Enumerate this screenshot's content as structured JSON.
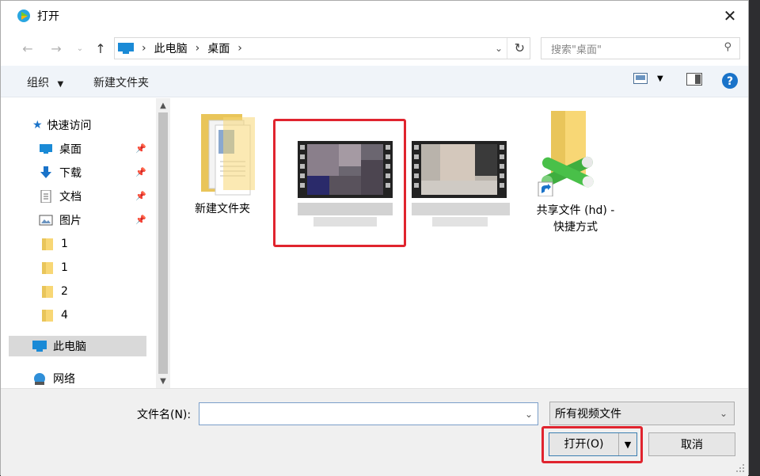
{
  "window": {
    "title": "打开"
  },
  "nav": {
    "back_icon": "back-arrow-icon",
    "forward_icon": "forward-arrow-icon",
    "up_icon": "up-arrow-icon",
    "breadcrumbs": [
      "此电脑",
      "桌面"
    ],
    "search_placeholder": "搜索\"桌面\""
  },
  "toolbar": {
    "organize_label": "组织",
    "new_folder_label": "新建文件夹"
  },
  "sidebar": {
    "items": [
      {
        "label": "快速访问",
        "icon": "star-icon"
      },
      {
        "label": "桌面",
        "icon": "desktop-icon",
        "pinned": true
      },
      {
        "label": "下载",
        "icon": "download-icon",
        "pinned": true
      },
      {
        "label": "文档",
        "icon": "document-icon",
        "pinned": true
      },
      {
        "label": "图片",
        "icon": "picture-icon",
        "pinned": true
      },
      {
        "label": "1",
        "icon": "folder-icon"
      },
      {
        "label": "1",
        "icon": "folder-icon"
      },
      {
        "label": "2",
        "icon": "folder-icon"
      },
      {
        "label": "4",
        "icon": "folder-icon"
      },
      {
        "label": "此电脑",
        "icon": "computer-icon",
        "selected": true
      },
      {
        "label": "网络",
        "icon": "network-icon"
      }
    ]
  },
  "files": [
    {
      "label": "新建文件夹",
      "type": "folder"
    },
    {
      "label": "",
      "type": "video",
      "highlighted": true
    },
    {
      "label": "",
      "type": "video"
    },
    {
      "label_line1": "共享文件 (hd) -",
      "label_line2": "快捷方式",
      "type": "shortcut"
    }
  ],
  "bottom": {
    "filename_label": "文件名(N):",
    "filename_value": "",
    "filetype_value": "所有视频文件",
    "open_label": "打开(O)",
    "cancel_label": "取消"
  },
  "colors": {
    "highlight_red": "#e0242e",
    "accent_blue": "#1a73c9"
  }
}
